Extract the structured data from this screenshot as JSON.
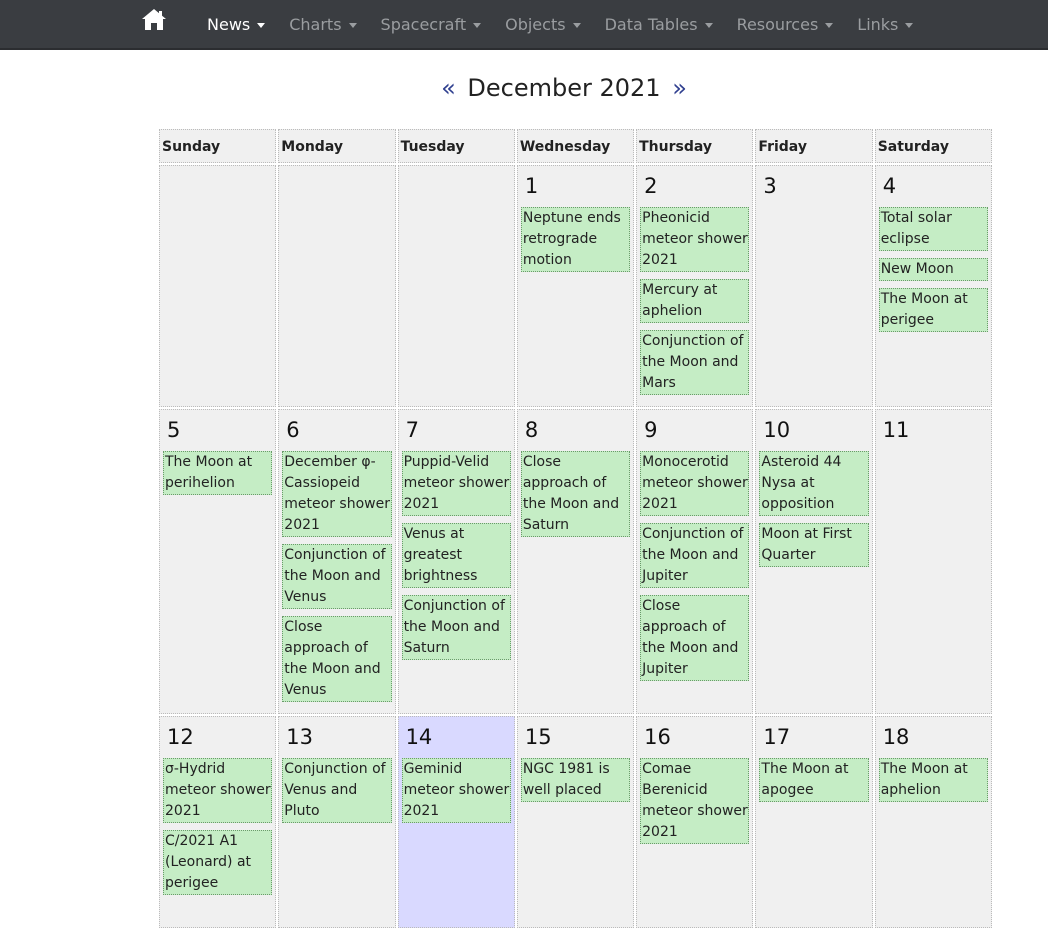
{
  "nav": {
    "home_icon": "home-icon",
    "items": [
      {
        "label": "News",
        "active": true
      },
      {
        "label": "Charts"
      },
      {
        "label": "Spacecraft"
      },
      {
        "label": "Objects"
      },
      {
        "label": "Data Tables"
      },
      {
        "label": "Resources"
      },
      {
        "label": "Links"
      }
    ]
  },
  "calendar": {
    "prev": "«",
    "title": "December 2021",
    "next": "»",
    "today_color": "#d9d9ff",
    "event_color": "#c5edc5",
    "weekdays": [
      "Sunday",
      "Monday",
      "Tuesday",
      "Wednesday",
      "Thursday",
      "Friday",
      "Saturday"
    ],
    "weeks": [
      [
        {
          "day": "",
          "events": []
        },
        {
          "day": "",
          "events": []
        },
        {
          "day": "",
          "events": []
        },
        {
          "day": "1",
          "events": [
            "Neptune ends retrograde motion"
          ]
        },
        {
          "day": "2",
          "events": [
            "Pheonicid meteor shower 2021",
            "Mercury at aphelion",
            "Conjunction of the Moon and Mars"
          ]
        },
        {
          "day": "3",
          "events": []
        },
        {
          "day": "4",
          "events": [
            "Total solar eclipse",
            "New Moon",
            "The Moon at perigee"
          ]
        }
      ],
      [
        {
          "day": "5",
          "events": [
            "The Moon at perihelion"
          ]
        },
        {
          "day": "6",
          "events": [
            "December φ-Cassiopeid meteor shower 2021",
            "Conjunction of the Moon and Venus",
            "Close approach of the Moon and Venus"
          ]
        },
        {
          "day": "7",
          "events": [
            "Puppid-Velid meteor shower 2021",
            "Venus at greatest brightness",
            "Conjunction of the Moon and Saturn"
          ]
        },
        {
          "day": "8",
          "events": [
            "Close approach of the Moon and Saturn"
          ]
        },
        {
          "day": "9",
          "events": [
            "Monocerotid meteor shower 2021",
            "Conjunction of the Moon and Jupiter",
            "Close approach of the Moon and Jupiter"
          ]
        },
        {
          "day": "10",
          "events": [
            "Asteroid 44 Nysa at opposition",
            "Moon at First Quarter"
          ]
        },
        {
          "day": "11",
          "events": []
        }
      ],
      [
        {
          "day": "12",
          "events": [
            "σ-Hydrid meteor shower 2021",
            "C/2021 A1 (Leonard) at perigee"
          ]
        },
        {
          "day": "13",
          "events": [
            "Conjunction of Venus and Pluto"
          ]
        },
        {
          "day": "14",
          "today": true,
          "events": [
            "Geminid meteor shower 2021"
          ]
        },
        {
          "day": "15",
          "events": [
            "NGC 1981 is well placed"
          ]
        },
        {
          "day": "16",
          "events": [
            "Comae Berenicid meteor shower 2021"
          ]
        },
        {
          "day": "17",
          "events": [
            "The Moon at apogee"
          ]
        },
        {
          "day": "18",
          "events": [
            "The Moon at aphelion"
          ]
        }
      ]
    ]
  }
}
